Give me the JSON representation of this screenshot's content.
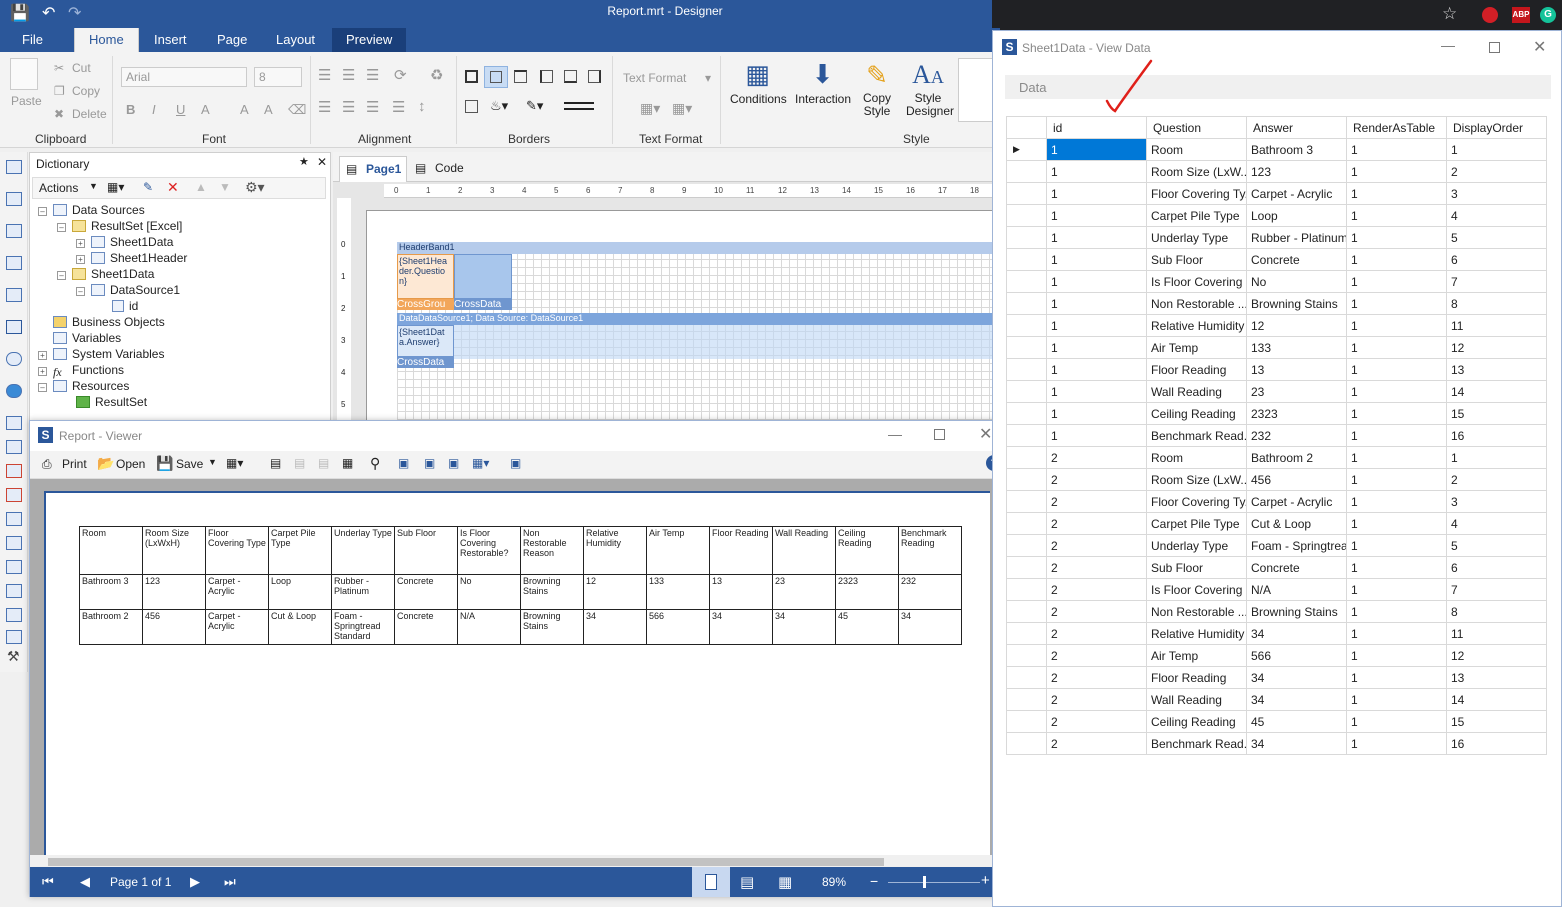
{
  "designer": {
    "title": "Report.mrt - Designer",
    "menu": [
      "File",
      "Home",
      "Insert",
      "Page",
      "Layout",
      "Preview"
    ],
    "clipboard": {
      "paste": "Paste",
      "cut": "Cut",
      "copy": "Copy",
      "delete": "Delete",
      "label": "Clipboard"
    },
    "font": {
      "name": "Arial",
      "size": "8",
      "label": "Font"
    },
    "alignment_label": "Alignment",
    "borders_label": "Borders",
    "text_format": {
      "combo": "Text Format",
      "label": "Text Format"
    },
    "style": {
      "conditions": "Conditions",
      "interaction": "Interaction",
      "copy_style": "Copy Style",
      "style_designer": "Style Designer",
      "label": "Style"
    }
  },
  "dictionary": {
    "title": "Dictionary",
    "actions": "Actions",
    "tree": [
      {
        "label": "Data Sources",
        "level": 0
      },
      {
        "label": "ResultSet [Excel]",
        "level": 1
      },
      {
        "label": "Sheet1Data",
        "level": 2
      },
      {
        "label": "Sheet1Header",
        "level": 2
      },
      {
        "label": "Sheet1Data",
        "level": 1
      },
      {
        "label": "DataSource1",
        "level": 2
      },
      {
        "label": "id",
        "level": 3
      },
      {
        "label": "Business Objects",
        "level": 0
      },
      {
        "label": "Variables",
        "level": 0
      },
      {
        "label": "System Variables",
        "level": 0
      },
      {
        "label": "Functions",
        "level": 0
      },
      {
        "label": "Resources",
        "level": 0
      },
      {
        "label": "ResultSet",
        "level": 1
      }
    ]
  },
  "page": {
    "tabs": [
      "Page1",
      "Code"
    ],
    "ruler": [
      "0",
      "1",
      "2",
      "3",
      "4",
      "5",
      "6",
      "7",
      "8",
      "9",
      "10",
      "11",
      "12",
      "13",
      "14",
      "15",
      "16",
      "17",
      "18"
    ],
    "vruler": [
      "0",
      "1",
      "2",
      "3",
      "4",
      "5"
    ],
    "bands": {
      "header": "HeaderBand1",
      "header_field": "{Sheet1Header.Question}",
      "cross_group": "CrossGrou",
      "cross_data": "CrossData",
      "data": "DataDataSource1; Data Source: DataSource1",
      "data_field": "{Sheet1Data.Answer}",
      "cross_data2": "CrossData"
    }
  },
  "viewer": {
    "title": "Report - Viewer",
    "toolbar": {
      "print": "Print",
      "open": "Open",
      "save": "Save"
    },
    "report": {
      "headers": [
        "Room",
        "Room Size (LxWxH)",
        "Floor Covering Type",
        "Carpet Pile Type",
        "Underlay Type",
        "Sub Floor",
        "Is Floor Covering Restorable?",
        "Non Restorable Reason",
        "Relative Humidity",
        "Air Temp",
        "Floor Reading",
        "Wall Reading",
        "Ceiling Reading",
        "Benchmark Reading"
      ],
      "rows": [
        [
          "Bathroom 3",
          "123",
          "Carpet - Acrylic",
          "Loop",
          "Rubber - Platinum",
          "Concrete",
          "No",
          "Browning Stains",
          "12",
          "133",
          "13",
          "23",
          "2323",
          "232"
        ],
        [
          "Bathroom 2",
          "456",
          "Carpet - Acrylic",
          "Cut & Loop",
          "Foam - Springtread Standard",
          "Concrete",
          "N/A",
          "Browning Stains",
          "34",
          "566",
          "34",
          "34",
          "45",
          "34"
        ]
      ]
    },
    "status": {
      "page": "Page 1 of 1",
      "zoom": "89%"
    }
  },
  "view_data": {
    "title": "Sheet1Data - View Data",
    "header": "Data",
    "columns": [
      "id",
      "Question",
      "Answer",
      "RenderAsTable",
      "DisplayOrder"
    ],
    "rows": [
      [
        "1",
        "Room",
        "Bathroom 3",
        "1",
        "1"
      ],
      [
        "1",
        "Room Size (LxW...",
        "123",
        "1",
        "2"
      ],
      [
        "1",
        "Floor Covering Ty...",
        "Carpet - Acrylic",
        "1",
        "3"
      ],
      [
        "1",
        "Carpet Pile Type",
        "Loop",
        "1",
        "4"
      ],
      [
        "1",
        "Underlay Type",
        "Rubber - Platinum",
        "1",
        "5"
      ],
      [
        "1",
        "Sub Floor",
        "Concrete",
        "1",
        "6"
      ],
      [
        "1",
        "Is Floor Covering ...",
        "No",
        "1",
        "7"
      ],
      [
        "1",
        "Non Restorable ...",
        "Browning Stains",
        "1",
        "8"
      ],
      [
        "1",
        "Relative Humidity",
        "12",
        "1",
        "11"
      ],
      [
        "1",
        "Air Temp",
        "133",
        "1",
        "12"
      ],
      [
        "1",
        "Floor Reading",
        "13",
        "1",
        "13"
      ],
      [
        "1",
        "Wall Reading",
        "23",
        "1",
        "14"
      ],
      [
        "1",
        "Ceiling Reading",
        "2323",
        "1",
        "15"
      ],
      [
        "1",
        "Benchmark Read...",
        "232",
        "1",
        "16"
      ],
      [
        "2",
        "Room",
        "Bathroom 2",
        "1",
        "1"
      ],
      [
        "2",
        "Room Size (LxW...",
        "456",
        "1",
        "2"
      ],
      [
        "2",
        "Floor Covering Ty...",
        "Carpet - Acrylic",
        "1",
        "3"
      ],
      [
        "2",
        "Carpet Pile Type",
        "Cut & Loop",
        "1",
        "4"
      ],
      [
        "2",
        "Underlay Type",
        "Foam - Springtrea...",
        "1",
        "5"
      ],
      [
        "2",
        "Sub Floor",
        "Concrete",
        "1",
        "6"
      ],
      [
        "2",
        "Is Floor Covering ...",
        "N/A",
        "1",
        "7"
      ],
      [
        "2",
        "Non Restorable ...",
        "Browning Stains",
        "1",
        "8"
      ],
      [
        "2",
        "Relative Humidity",
        "34",
        "1",
        "11"
      ],
      [
        "2",
        "Air Temp",
        "566",
        "1",
        "12"
      ],
      [
        "2",
        "Floor Reading",
        "34",
        "1",
        "13"
      ],
      [
        "2",
        "Wall Reading",
        "34",
        "1",
        "14"
      ],
      [
        "2",
        "Ceiling Reading",
        "45",
        "1",
        "15"
      ],
      [
        "2",
        "Benchmark Read...",
        "34",
        "1",
        "16"
      ]
    ]
  },
  "colors": {
    "brand": "#2b579a",
    "selection": "#0078d7",
    "crossgroup": "#f2a65a",
    "band": "#9dbce6"
  },
  "chrome": {
    "abp": "ABP",
    "g": "G"
  }
}
